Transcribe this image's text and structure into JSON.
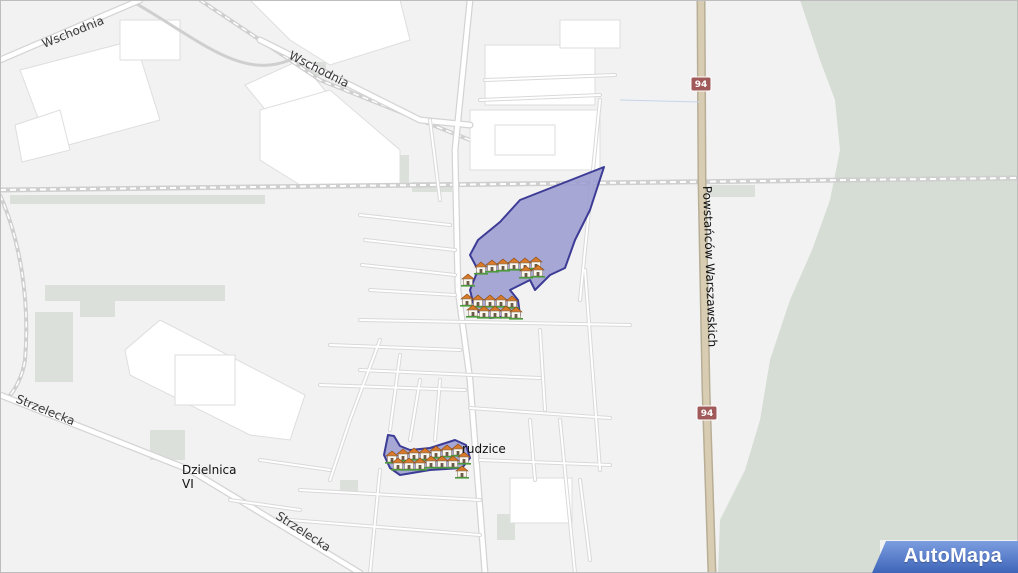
{
  "map": {
    "labels": {
      "wschodnia_1": "Wschodnia",
      "wschodnia_2": "Wschodnia",
      "strzelecka_1": "Strzelecka",
      "strzelecka_2": "Strzelecka",
      "powstancow": "Powstańców Warszawskich",
      "district_line1": "Dzielnica",
      "district_line2": "VI",
      "settlement": "rudzice"
    },
    "road_shields": {
      "top": "94",
      "bottom": "94"
    },
    "colors": {
      "background": "#f2f2f2",
      "forest": "#d6ddd4",
      "green_area": "#dbe1da",
      "building": "#ffffff",
      "road": "#ffffff",
      "road_casing": "#d4d4d4",
      "main_road": "#c8bfa8",
      "shield": "#a05a5a",
      "highlight_fill": "#9a9ad0",
      "highlight_stroke": "#3c3c96",
      "brand": "#4a73c4"
    }
  },
  "brand": {
    "name": "AutoMapa"
  }
}
